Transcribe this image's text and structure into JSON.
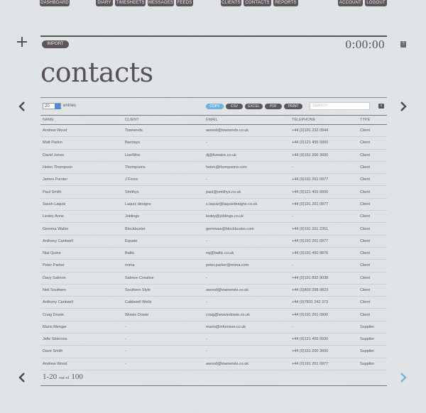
{
  "nav": {
    "dashboard": "DASHBOARD",
    "diary": "DIARY",
    "timesheets": "TIMESHEETS",
    "messages": "MESSAGES",
    "feeds": "FEEDS",
    "clients": "CLIENTS",
    "contacts": "CONTACTS",
    "reports": "REPORTS",
    "account": "ACCOUNT",
    "logout": "LOGOUT"
  },
  "toolbar": {
    "import_label": "IMPORT",
    "timer": "0:00:00",
    "help": "?"
  },
  "page": {
    "title": "contacts"
  },
  "controls": {
    "length_value": "20",
    "entries_label": "entries",
    "search_placeholder": "SEARCH",
    "clear": "x",
    "export": {
      "copy": "COPY",
      "csv": "CSV",
      "excel": "EXCEL",
      "pdf": "PDF",
      "print": "PRINT"
    }
  },
  "table": {
    "columns": [
      "NAME",
      "CLIENT",
      "EMAIL",
      "TELEPHONE",
      "TYPE"
    ],
    "rows": [
      [
        "Andrew Wood",
        "Townends",
        "awood@townends.co.uk",
        "+44 (0)191 232 0944",
        "Client"
      ],
      [
        "Matt Parkin",
        "Barclays",
        "-",
        "+44 (0)121 455 0000",
        "Client"
      ],
      [
        "David Jones",
        "LiveWire",
        "dj@livewire.co.uk",
        "+44 (0)151 200 3000",
        "Client"
      ],
      [
        "Helen Thompson",
        "Thompsons",
        "helen@thompsons.com",
        "-",
        "Client"
      ],
      [
        "James Forster",
        "J Force",
        "-",
        "+44 (0)191 261 0977",
        "Client"
      ],
      [
        "Paul Smith",
        "Smithys",
        "paul@smithys.co.uk",
        "+44 (0)121 455 0000",
        "Client"
      ],
      [
        "Sarah Laquiz",
        "Laquiz designs",
        "s.laquiz@laquizdesigns.co.uk",
        "+44 (0)191 261 0977",
        "Client"
      ],
      [
        "Lesley Anne",
        "Joblings",
        "lesley@joblings.co.uk",
        "-",
        "Client"
      ],
      [
        "Gemma Waller",
        "Blockbuster",
        "gemmaw@blockbuster.com",
        "+44 (0)191 261 2351",
        "Client"
      ],
      [
        "Anthony Cantwell",
        "Equate",
        "-",
        "+44 (0)191 261 0977",
        "Client"
      ],
      [
        "Nial Quinn",
        "Baltic",
        "nq@baltic.co.uk",
        "+44 (0)191 450 9876",
        "Client"
      ],
      [
        "Peter Parker",
        "mima",
        "peter.parker@mima.com",
        "-",
        "Client"
      ],
      [
        "Davy Salmon",
        "Salmon Creative",
        "-",
        "+44 (0)191 892 9038",
        "Client"
      ],
      [
        "Neil Southern",
        "Southern Style",
        "awood@townends.co.uk",
        "+44 (0)800 398 0823",
        "Client"
      ],
      [
        "Anthony Cantwell",
        "Cabbwell Wells",
        "-",
        "+44 (0)7801 242 373",
        "Client"
      ],
      [
        "Craig Dowie",
        "Wowie Dowie",
        "craig@wowiedowie.co.uk",
        "+44 (0)191 261 0900",
        "Client"
      ],
      [
        "Mario Menger",
        "-",
        "mario@infomixer.co.uk",
        "-",
        "Supplier"
      ],
      [
        "Jelle Stokroos",
        "-",
        "-",
        "+44 (0)121 455 0000",
        "Supplier"
      ],
      [
        "Dave Smith",
        "-",
        "-",
        "+44 (0)151 200 3000",
        "Supplier"
      ],
      [
        "Andrew Wood",
        "-",
        "awood@townends.co.uk",
        "+44 (0)191 261 0977",
        "Supplier"
      ]
    ]
  },
  "pagination": {
    "range": "1-20",
    "of_label": "out of",
    "total": "100"
  },
  "colors": {
    "tab_bg": "#5c5758",
    "accent": "#6fb4de",
    "background": "#dfe2e5"
  }
}
